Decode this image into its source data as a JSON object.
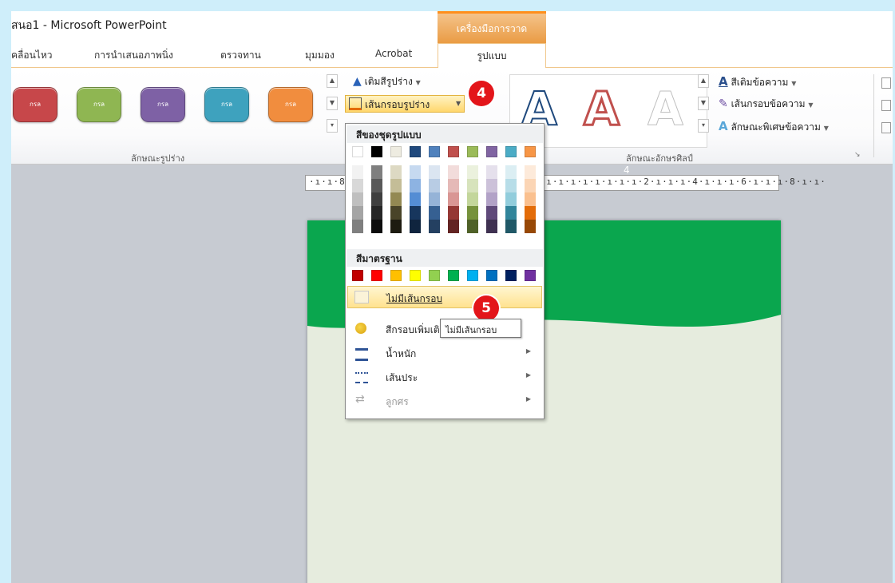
{
  "window": {
    "title": "สนอ1  -  Microsoft PowerPoint"
  },
  "contextual": {
    "label": "เครื่องมือการวาด"
  },
  "tabs": [
    "คลื่อนไหว",
    "การนำเสนอภาพนิ่ง",
    "ตรวจทาน",
    "มุมมอง",
    "Acrobat",
    "รูปแบบ"
  ],
  "shape_styles": {
    "group_label": "ลักษณะรูปร่าง",
    "swatch_text": "กรล",
    "colors": [
      "#c7474a",
      "#8fb652",
      "#7e61a5",
      "#3ea2be",
      "#f18d3e"
    ]
  },
  "fill_button": "เติมสีรูปร่าง",
  "outline_button": "เส้นกรอบรูปร่าง",
  "wordart": {
    "group_label": "ลักษณะอักษรศิลป์",
    "letter": "A",
    "text_fill": "สีเติมข้อความ",
    "text_outline": "เส้นกรอบข้อความ",
    "text_effects": "ลักษณะพิเศษข้อความ"
  },
  "badges": {
    "step4": "4",
    "step5": "5"
  },
  "ruler": {
    "text": "·ı·ı·8·ı·ı·6·ı·ı·4·ı·ı·2·ı·ı·ı·ı·ı·ı·ı·ı·ı·ı·ı·ı·ı·ı·ı·2·ı·ı·ı·4·ı·ı·ı·6·ı·ı·ı·8·ı·ı·",
    "marker": "4"
  },
  "dropdown": {
    "theme_header": "สีของชุดรูปแบบ",
    "standard_header": "สีมาตรฐาน",
    "theme_top": [
      "#ffffff",
      "#000000",
      "#eeece1",
      "#1f497d",
      "#4f81bd",
      "#c0504d",
      "#9bbb59",
      "#8064a2",
      "#4bacc6",
      "#f79646"
    ],
    "theme_shades": [
      [
        "#f2f2f2",
        "#d8d8d8",
        "#bfbfbf",
        "#a5a5a5",
        "#7f7f7f"
      ],
      [
        "#7f7f7f",
        "#595959",
        "#3f3f3f",
        "#262626",
        "#0c0c0c"
      ],
      [
        "#ddd9c3",
        "#c4bd97",
        "#938953",
        "#494429",
        "#1d1b10"
      ],
      [
        "#c6d9f0",
        "#8db3e2",
        "#548dd4",
        "#17365d",
        "#0f243e"
      ],
      [
        "#dbe5f1",
        "#b8cce4",
        "#95b3d7",
        "#366092",
        "#244061"
      ],
      [
        "#f2dcdb",
        "#e5b9b7",
        "#d99694",
        "#953734",
        "#632423"
      ],
      [
        "#ebf1dd",
        "#d7e3bc",
        "#c3d69b",
        "#76923c",
        "#4f6128"
      ],
      [
        "#e5e0ec",
        "#ccc1d9",
        "#b2a2c7",
        "#5f497a",
        "#3f3151"
      ],
      [
        "#dbeef3",
        "#b7dde8",
        "#92cddc",
        "#31859b",
        "#205867"
      ],
      [
        "#fdeada",
        "#fbd5b5",
        "#fac08f",
        "#e36c09",
        "#974806"
      ]
    ],
    "standard": [
      "#c00000",
      "#ff0000",
      "#ffc000",
      "#ffff00",
      "#92d050",
      "#00b050",
      "#00b0f0",
      "#0070c0",
      "#002060",
      "#7030a0"
    ],
    "no_outline": "ไม่มีเส้นกรอบ",
    "more_colors": "สีกรอบเพิ่มเติม",
    "weight": "น้ำหนัก",
    "dashes": "เส้นประ",
    "arrows": "ลูกศร"
  },
  "tooltip": "ไม่มีเส้นกรอบ",
  "slide": {
    "band_color": "#0aa64e",
    "background": "#e6ecde"
  }
}
